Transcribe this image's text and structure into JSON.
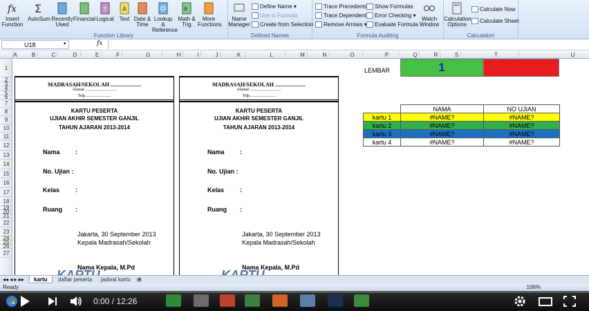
{
  "ribbon": {
    "groups": [
      {
        "label": "Function Library"
      },
      {
        "label": "Defined Names"
      },
      {
        "label": "Formula Auditing"
      },
      {
        "label": "Calculation"
      }
    ],
    "buttons": {
      "insert_function": "Insert Function",
      "autosum": "AutoSum",
      "recently_used": "Recently Used",
      "financial": "Financial",
      "logical": "Logical",
      "text": "Text",
      "date_time": "Date & Time",
      "lookup": "Lookup & Reference",
      "math": "Math & Trig",
      "more": "More Functions",
      "name_manager": "Name Manager",
      "define_name": "Define Name",
      "use_in_formula": "Use in Formula",
      "create_from_selection": "Create from Selection",
      "trace_precedents": "Trace Precedents",
      "trace_dependents": "Trace Dependents",
      "remove_arrows": "Remove Arrows",
      "show_formulas": "Show Formulas",
      "error_checking": "Error Checking",
      "evaluate_formula": "Evaluate Formula",
      "watch_window": "Watch Window",
      "calc_options": "Calculation Options",
      "calculate_now": "Calculate Now",
      "calculate_sheet": "Calculate Sheet"
    }
  },
  "formula_bar": {
    "name_box": "U18",
    "fx": "fx",
    "formula": ""
  },
  "columns": [
    "A",
    "B",
    "C",
    "D",
    "E",
    "F",
    "G",
    "H",
    "I",
    "J",
    "K",
    "L",
    "M",
    "N",
    "O",
    "P",
    "Q",
    "R",
    "S",
    "T",
    "U",
    "V"
  ],
  "rows": [
    "1",
    "2",
    "3",
    "4",
    "5",
    "6",
    "7",
    "8",
    "9",
    "10",
    "11",
    "12",
    "13",
    "14",
    "15",
    "16",
    "17",
    "18",
    "19",
    "20",
    "21",
    "22",
    "23",
    "24",
    "25",
    "26",
    "27"
  ],
  "card": {
    "school": "MADRASAH/SEKOLAH ......................",
    "alamat": "Alamat ..............................",
    "telp": "Telp.........................",
    "title1": "KARTU PESERTA",
    "title2": "UJIAN AKHIR  SEMESTER GANJIL",
    "title3": "TAHUN AJARAN 2013-2014",
    "nama": "Nama",
    "no_ujian": "No. Ujian :",
    "kelas": "Kelas",
    "ruang": "Ruang",
    "colon": ":",
    "date": "Jakarta, 30 September 2013",
    "role": "Kepala Madrasah/Sekolah",
    "signer": "Nama Kepala, M.Pd",
    "watermark": "KARTU"
  },
  "lembar": {
    "label": "LEMBAR",
    "value": "1",
    "green": "#44c044",
    "red": "#e81c1c"
  },
  "table": {
    "headers": [
      "",
      "NAMA",
      "NO UJIAN"
    ],
    "rows": [
      {
        "kartu": "kartu 1",
        "nama": "#NAME?",
        "no": "#NAME?",
        "color": "#ffff00"
      },
      {
        "kartu": "kartu 2",
        "nama": "#NAME?",
        "no": "#NAME?",
        "color": "#2fb04a"
      },
      {
        "kartu": "kartu 3",
        "nama": "#NAME?",
        "no": "#NAME?",
        "color": "#1f6fc4"
      },
      {
        "kartu": "kartu 4",
        "nama": "#NAME?",
        "no": "#NAME?",
        "color": "#ffffff"
      }
    ]
  },
  "tabs": {
    "items": [
      "kartu",
      "daftar peserta",
      "jadwal kartu"
    ]
  },
  "status": {
    "ready": "Ready",
    "zoom": "106%"
  },
  "player": {
    "time": "0:00 / 12:26",
    "progress": 0.0
  }
}
